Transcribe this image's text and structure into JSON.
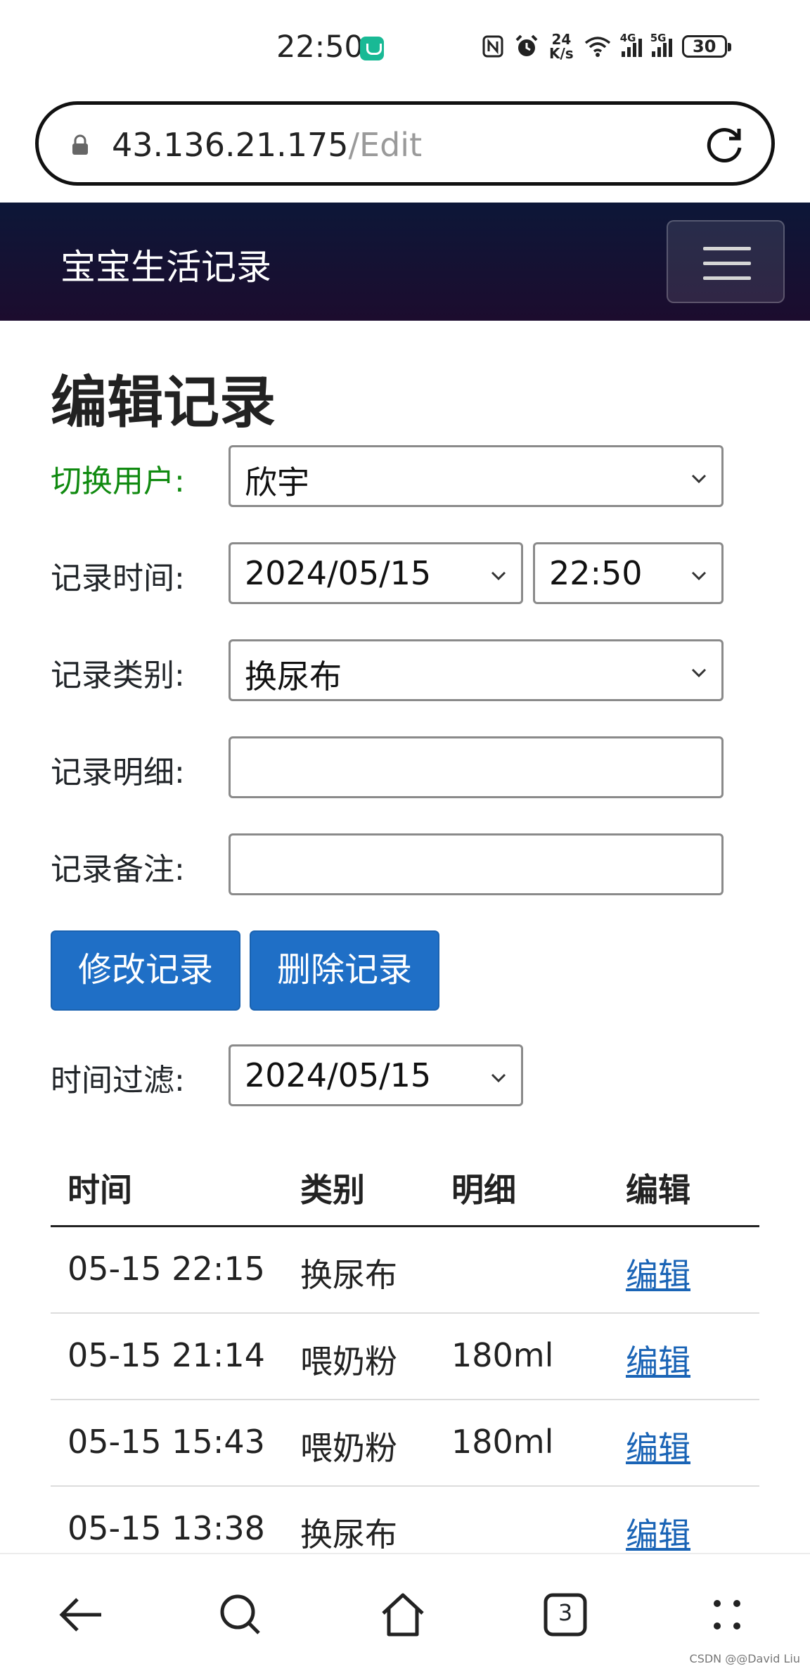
{
  "status_bar": {
    "time": "22:50",
    "net_speed_top": "24",
    "net_speed_bottom": "K/s",
    "sim1_label": "4G",
    "sim2_label": "5G",
    "battery": "30"
  },
  "browser": {
    "url_host": "43.136.21.175",
    "url_path": "/Edit",
    "tabs_count": "3"
  },
  "navbar": {
    "brand": "宝宝生活记录"
  },
  "page": {
    "title": "编辑记录"
  },
  "form": {
    "user_label": "切换用户:",
    "user_value": "欣宇",
    "time_label": "记录时间:",
    "date_value": "2024/05/15",
    "time_value": "22:50",
    "category_label": "记录类别:",
    "category_value": "换尿布",
    "detail_label": "记录明细:",
    "detail_value": "",
    "note_label": "记录备注:",
    "note_value": "",
    "update_button": "修改记录",
    "delete_button": "删除记录",
    "filter_label": "时间过滤:",
    "filter_value": "2024/05/15"
  },
  "table": {
    "headers": [
      "时间",
      "类别",
      "明细",
      "编辑"
    ],
    "rows": [
      {
        "time": "05-15 22:15",
        "category": "换尿布",
        "detail": "",
        "action": "编辑"
      },
      {
        "time": "05-15 21:14",
        "category": "喂奶粉",
        "detail": "180ml",
        "action": "编辑"
      },
      {
        "time": "05-15 15:43",
        "category": "喂奶粉",
        "detail": "180ml",
        "action": "编辑"
      },
      {
        "time": "05-15 13:38",
        "category": "换尿布",
        "detail": "",
        "action": "编辑"
      }
    ]
  },
  "watermark": "CSDN @@David Liu",
  "colors": {
    "primary": "#1f6fc6",
    "navbar_top": "#0d1738",
    "navbar_bottom": "#1c0c2e",
    "label_green": "#108a10",
    "link": "#1a64b6"
  }
}
